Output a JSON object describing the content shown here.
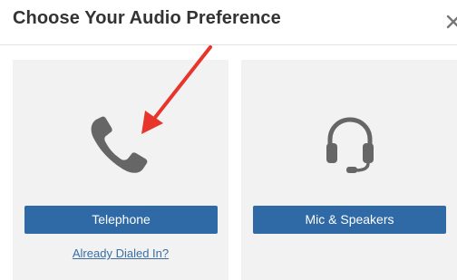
{
  "dialog": {
    "title": "Choose Your Audio Preference"
  },
  "options": {
    "telephone": {
      "label": "Telephone",
      "link": "Already Dialed In?",
      "icon": "phone-icon"
    },
    "mic": {
      "label": "Mic & Speakers",
      "icon": "headset-icon"
    }
  },
  "icons": {
    "close": "close-icon",
    "annotation": "red-arrow-annotation"
  },
  "colors": {
    "button": "#2f6aa6",
    "card": "#f2f2f2",
    "icon": "#666666",
    "link": "#3a6ea5",
    "annotation": "#e8352c"
  }
}
